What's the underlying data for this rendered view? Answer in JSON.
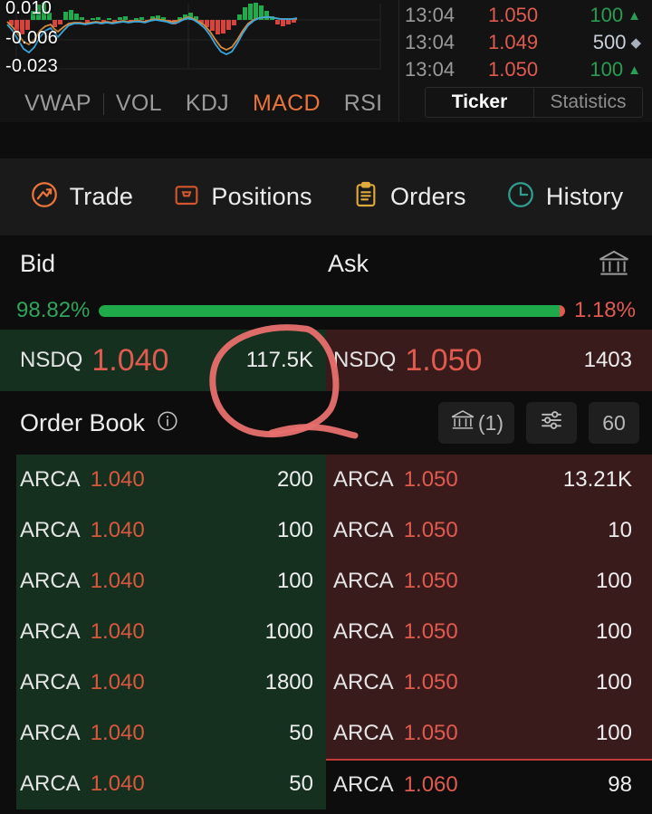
{
  "chart_data": {
    "type": "line",
    "title": "MACD",
    "ylabel": "",
    "xlabel": "",
    "ytick_labels": [
      "0.010",
      "-0.006",
      "-0.023"
    ],
    "ylim": [
      -0.023,
      0.01
    ],
    "grid": true,
    "legend_position": "none",
    "series": [
      {
        "name": "MACD",
        "color": "#3aa7dc",
        "values": [
          -0.004,
          -0.01,
          -0.017,
          -0.022,
          -0.019,
          -0.013,
          -0.009,
          -0.008,
          -0.006,
          -0.004,
          -0.003,
          -0.002,
          -0.002,
          -0.002,
          -0.002,
          -0.002,
          -0.001,
          -0.001,
          0.0,
          0.0,
          -0.001,
          -0.001,
          -0.002,
          -0.007,
          -0.014,
          -0.019,
          -0.02,
          -0.017,
          -0.01,
          -0.004,
          0.0,
          0.001
        ]
      },
      {
        "name": "Signal",
        "color": "#d98a3c",
        "values": [
          -0.002,
          -0.006,
          -0.012,
          -0.018,
          -0.018,
          -0.011,
          -0.006,
          -0.006,
          -0.005,
          -0.004,
          -0.003,
          -0.002,
          -0.002,
          -0.002,
          -0.001,
          -0.001,
          -0.001,
          0.0,
          0.0,
          0.001,
          0.0,
          0.0,
          -0.002,
          -0.006,
          -0.012,
          -0.017,
          -0.019,
          -0.016,
          -0.01,
          -0.004,
          0.0,
          0.001
        ]
      },
      {
        "name": "Histogram",
        "color": "mixed",
        "values": [
          -0.002,
          -0.005,
          -0.006,
          -0.004,
          0.003,
          0.007,
          0.009,
          0.002,
          0.003,
          0.004,
          0.001,
          0.0,
          0.0,
          0.0,
          0.001,
          0.001,
          0.001,
          0.001,
          0.001,
          0.0,
          -0.001,
          -0.002,
          -0.003,
          -0.005,
          -0.005,
          -0.003,
          0.002,
          0.006,
          0.008,
          0.004,
          -0.001,
          -0.002
        ]
      }
    ]
  },
  "indicators": {
    "tabs": [
      {
        "label": "VWAP",
        "active": false
      },
      {
        "label": "VOL",
        "active": false
      },
      {
        "label": "KDJ",
        "active": false
      },
      {
        "label": "MACD",
        "active": true
      },
      {
        "label": "RSI",
        "active": false
      }
    ]
  },
  "ticker": {
    "rows": [
      {
        "time": "13:04",
        "price": "1.050",
        "size": "100",
        "mark": "▲",
        "tone": "up"
      },
      {
        "time": "13:04",
        "price": "1.049",
        "size": "500",
        "mark": "◆",
        "tone": "neutral"
      },
      {
        "time": "13:04",
        "price": "1.050",
        "size": "100",
        "mark": "▲",
        "tone": "up"
      }
    ],
    "tabs": [
      {
        "label": "Ticker",
        "active": true
      },
      {
        "label": "Statistics",
        "active": false
      }
    ]
  },
  "nav": {
    "items": [
      {
        "label": "Trade",
        "icon": "trade-icon",
        "color": "#e8743b"
      },
      {
        "label": "Positions",
        "icon": "briefcase-icon",
        "color": "#d4552e"
      },
      {
        "label": "Orders",
        "icon": "clipboard-icon",
        "color": "#e0a93b"
      },
      {
        "label": "History",
        "icon": "clock-icon",
        "color": "#2f9e8f"
      }
    ]
  },
  "bidask": {
    "bid_label": "Bid",
    "ask_label": "Ask",
    "bank_icon": "bank-icon",
    "ratio": {
      "bid_pct": "98.82%",
      "ask_pct": "1.18%",
      "bid_value": 98.82,
      "ask_value": 1.18
    },
    "best_bid": {
      "mm": "NSDQ",
      "price": "1.040",
      "size": "117.5K"
    },
    "best_ask": {
      "mm": "NSDQ",
      "price": "1.050",
      "size": "1403"
    }
  },
  "orderbook": {
    "title": "Order Book",
    "info_icon": "info-icon",
    "buttons": [
      {
        "name": "venue-filter-button",
        "icon": "bank-icon",
        "label": "(1)"
      },
      {
        "name": "settings-button",
        "icon": "sliders-icon",
        "label": ""
      },
      {
        "name": "depth-rows-button",
        "icon": "",
        "label": "60"
      }
    ],
    "bids": [
      {
        "mm": "ARCA",
        "price": "1.040",
        "size": "200"
      },
      {
        "mm": "ARCA",
        "price": "1.040",
        "size": "100"
      },
      {
        "mm": "ARCA",
        "price": "1.040",
        "size": "100"
      },
      {
        "mm": "ARCA",
        "price": "1.040",
        "size": "1000"
      },
      {
        "mm": "ARCA",
        "price": "1.040",
        "size": "1800"
      },
      {
        "mm": "ARCA",
        "price": "1.040",
        "size": "50"
      },
      {
        "mm": "ARCA",
        "price": "1.040",
        "size": "50"
      }
    ],
    "asks": [
      {
        "mm": "ARCA",
        "price": "1.050",
        "size": "13.21K",
        "divider": false
      },
      {
        "mm": "ARCA",
        "price": "1.050",
        "size": "10",
        "divider": false
      },
      {
        "mm": "ARCA",
        "price": "1.050",
        "size": "100",
        "divider": false
      },
      {
        "mm": "ARCA",
        "price": "1.050",
        "size": "100",
        "divider": false
      },
      {
        "mm": "ARCA",
        "price": "1.050",
        "size": "100",
        "divider": false
      },
      {
        "mm": "ARCA",
        "price": "1.050",
        "size": "100",
        "divider": false
      },
      {
        "mm": "ARCA",
        "price": "1.060",
        "size": "98",
        "divider": true
      }
    ]
  },
  "annotation": {
    "kind": "hand-drawn-circle",
    "color": "#e8706e",
    "targets": "117.5K"
  },
  "colors": {
    "up": "#2ea55a",
    "down": "#e05a4f",
    "accent": "#e8743b",
    "bid_bg": "#15301f",
    "ask_bg": "#3a1b1b"
  }
}
